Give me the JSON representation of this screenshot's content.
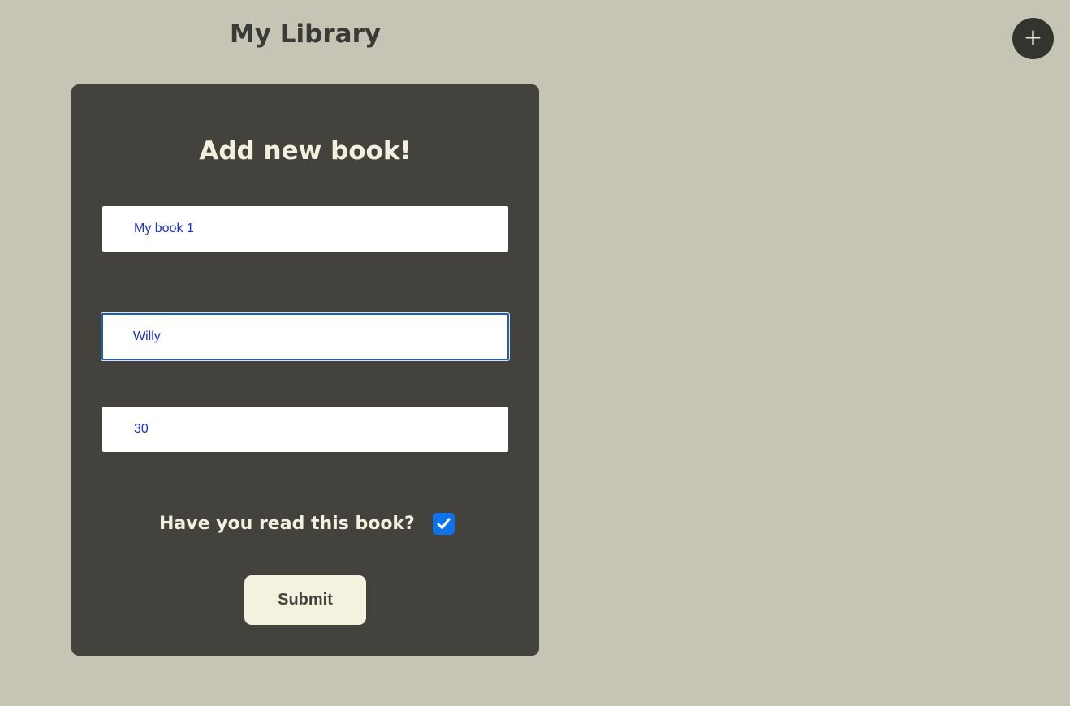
{
  "header": {
    "title": "My Library",
    "add_button_label": "+",
    "add_button_icon": "plus-icon"
  },
  "form": {
    "heading": "Add new book!",
    "title_field": {
      "value": "My book 1"
    },
    "author_field": {
      "value": "Willy"
    },
    "pages_field": {
      "value": "30"
    },
    "read_question": "Have you read this book?",
    "read_checked": true,
    "submit_label": "Submit"
  },
  "colors": {
    "background": "#c6c4b4",
    "card": "#43423d",
    "accent_text": "#f3f1de",
    "input_text": "#1a2fd6",
    "checkbox": "#0b73ec",
    "fab": "#34342f"
  }
}
